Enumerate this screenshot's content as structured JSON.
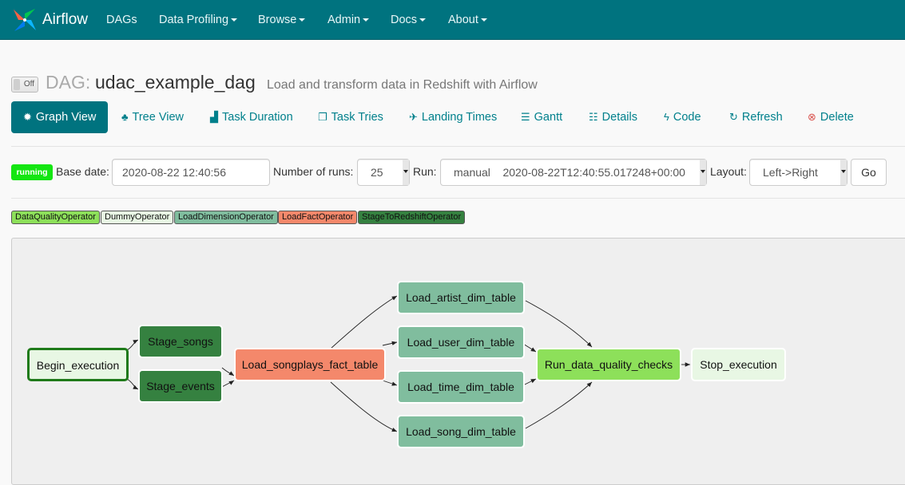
{
  "nav": {
    "brand": "Airflow",
    "items": [
      {
        "label": "DAGs",
        "dropdown": false
      },
      {
        "label": "Data Profiling",
        "dropdown": true
      },
      {
        "label": "Browse",
        "dropdown": true
      },
      {
        "label": "Admin",
        "dropdown": true
      },
      {
        "label": "Docs",
        "dropdown": true
      },
      {
        "label": "About",
        "dropdown": true
      }
    ]
  },
  "dag": {
    "toggle_label": "Off",
    "prefix": "DAG:",
    "id": "udac_example_dag",
    "description": "Load and transform data in Redshift with Airflow"
  },
  "tabs": [
    {
      "label": "Graph View",
      "icon": "asterisk-icon",
      "active": true
    },
    {
      "label": "Tree View",
      "icon": "tree-icon",
      "active": false
    },
    {
      "label": "Task Duration",
      "icon": "bar-chart-icon",
      "active": false
    },
    {
      "label": "Task Tries",
      "icon": "duplicate-icon",
      "active": false
    },
    {
      "label": "Landing Times",
      "icon": "plane-icon",
      "active": false
    },
    {
      "label": "Gantt",
      "icon": "align-left-icon",
      "active": false
    },
    {
      "label": "Details",
      "icon": "list-icon",
      "active": false
    },
    {
      "label": "Code",
      "icon": "flash-icon",
      "active": false
    },
    {
      "label": "Refresh",
      "icon": "refresh-icon",
      "active": false
    },
    {
      "label": "Delete",
      "icon": "remove-circle-icon",
      "active": false
    }
  ],
  "form": {
    "state_badge": "running",
    "base_date_label": "Base date:",
    "base_date_value": "2020-08-22 12:40:56",
    "num_runs_label": "Number of runs:",
    "num_runs_value": "25",
    "run_label": "Run:",
    "run_value": "manual    2020-08-22T12:40:55.017248+00:00",
    "layout_label": "Layout:",
    "layout_value": "Left->Right",
    "go_label": "Go"
  },
  "colors": {
    "navbar": "#00737f",
    "running": "#14e612",
    "DataQualityOperator": "#8de05a",
    "DummyOperator": "#e8f7e4",
    "LoadDimensionOperator": "#80bd9e",
    "LoadFactOperator": "#f4886b",
    "StageToRedshiftOperator": "#358140"
  },
  "legend": [
    {
      "label": "DataQualityOperator",
      "color": "#8de05a"
    },
    {
      "label": "DummyOperator",
      "color": "#e8f7e4"
    },
    {
      "label": "LoadDimensionOperator",
      "color": "#80bd9e"
    },
    {
      "label": "LoadFactOperator",
      "color": "#f4886b"
    },
    {
      "label": "StageToRedshiftOperator",
      "color": "#358140"
    }
  ],
  "graph": {
    "nodes": [
      {
        "id": "Begin_execution",
        "label": "Begin_execution",
        "operator": "DummyOperator",
        "state": "success"
      },
      {
        "id": "Stage_songs",
        "label": "Stage_songs",
        "operator": "StageToRedshiftOperator"
      },
      {
        "id": "Stage_events",
        "label": "Stage_events",
        "operator": "StageToRedshiftOperator"
      },
      {
        "id": "Load_songplays_fact_table",
        "label": "Load_songplays_fact_table",
        "operator": "LoadFactOperator"
      },
      {
        "id": "Load_artist_dim_table",
        "label": "Load_artist_dim_table",
        "operator": "LoadDimensionOperator"
      },
      {
        "id": "Load_user_dim_table",
        "label": "Load_user_dim_table",
        "operator": "LoadDimensionOperator"
      },
      {
        "id": "Load_time_dim_table",
        "label": "Load_time_dim_table",
        "operator": "LoadDimensionOperator"
      },
      {
        "id": "Load_song_dim_table",
        "label": "Load_song_dim_table",
        "operator": "LoadDimensionOperator"
      },
      {
        "id": "Run_data_quality_checks",
        "label": "Run_data_quality_checks",
        "operator": "DataQualityOperator"
      },
      {
        "id": "Stop_execution",
        "label": "Stop_execution",
        "operator": "DummyOperator"
      }
    ],
    "edges": [
      [
        "Begin_execution",
        "Stage_songs"
      ],
      [
        "Begin_execution",
        "Stage_events"
      ],
      [
        "Stage_songs",
        "Load_songplays_fact_table"
      ],
      [
        "Stage_events",
        "Load_songplays_fact_table"
      ],
      [
        "Load_songplays_fact_table",
        "Load_artist_dim_table"
      ],
      [
        "Load_songplays_fact_table",
        "Load_user_dim_table"
      ],
      [
        "Load_songplays_fact_table",
        "Load_time_dim_table"
      ],
      [
        "Load_songplays_fact_table",
        "Load_song_dim_table"
      ],
      [
        "Load_artist_dim_table",
        "Run_data_quality_checks"
      ],
      [
        "Load_user_dim_table",
        "Run_data_quality_checks"
      ],
      [
        "Load_time_dim_table",
        "Run_data_quality_checks"
      ],
      [
        "Load_song_dim_table",
        "Run_data_quality_checks"
      ],
      [
        "Run_data_quality_checks",
        "Stop_execution"
      ]
    ]
  }
}
